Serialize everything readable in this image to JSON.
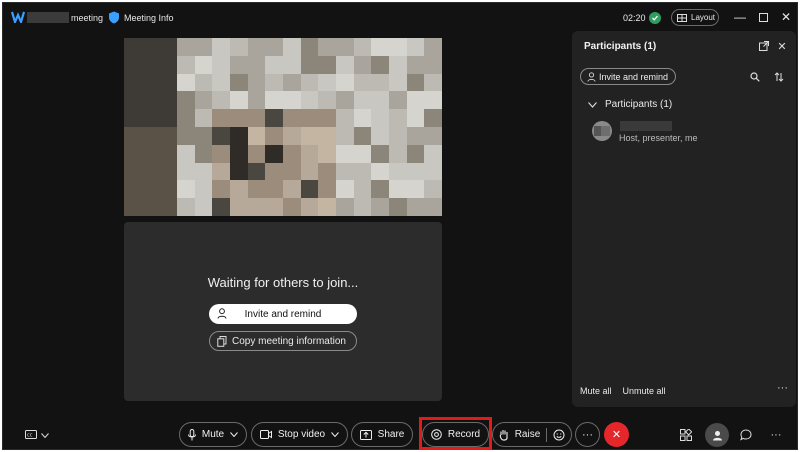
{
  "titlebar": {
    "title": "meeting",
    "meeting_info": "Meeting Info",
    "time": "02:20",
    "layout_label": "Layout"
  },
  "stage": {
    "waiting_text": "Waiting for others to join...",
    "invite_label": "Invite and remind",
    "copy_label": "Copy meeting information"
  },
  "participants_panel": {
    "title": "Participants (1)",
    "invite_label": "Invite and remind",
    "section_label": "Participants (1)",
    "participant_role": "Host, presenter, me",
    "mute_all": "Mute all",
    "unmute_all": "Unmute all"
  },
  "toolbar": {
    "mute_label": "Mute",
    "stop_video_label": "Stop video",
    "share_label": "Share",
    "record_label": "Record",
    "raise_label": "Raise",
    "more_label": "···"
  },
  "colors": {
    "window_bg": "#121212",
    "panel_bg": "#222222",
    "end_call": "#e5272b",
    "record_highlight": "#e21a1a",
    "security_badge": "#2e9e5e"
  },
  "icons": [
    "webex-logo",
    "shield-icon",
    "layout-icon",
    "minimize-icon",
    "maximize-icon",
    "close-icon",
    "popout-icon",
    "search-icon",
    "sort-icon",
    "person-icon",
    "copy-icon",
    "chevron-down-icon",
    "microphone-icon",
    "camera-icon",
    "share-icon",
    "record-icon",
    "hand-icon",
    "reaction-icon",
    "end-call-icon",
    "apps-icon",
    "participants-icon",
    "chat-icon",
    "more-icon",
    "captions-icon"
  ]
}
